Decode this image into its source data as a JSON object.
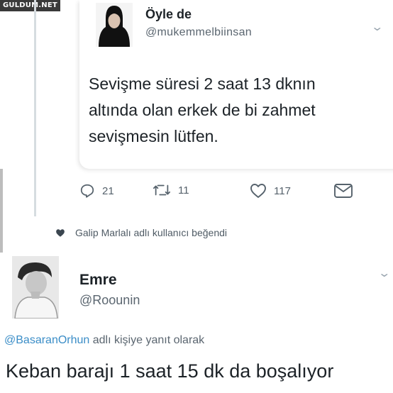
{
  "watermark": "GULDUM.NET",
  "quoted_tweet": {
    "display_name": "Öyle de",
    "handle": "@mukemmelbiinsan",
    "text_lines": [
      "Sevişme süresi 2 saat 13 dknın",
      "altında olan erkek de bi zahmet",
      "sevişmesin lütfen."
    ],
    "actions": {
      "reply_count": "21",
      "retweet_count": "11",
      "like_count": "117"
    },
    "liked_by_text": "Galip Marlalı adlı kullanıcı beğendi",
    "icons": [
      "reply-icon",
      "retweet-icon",
      "like-icon",
      "message-icon",
      "heart-icon",
      "chevron-down-icon"
    ]
  },
  "reply_tweet": {
    "display_name": "Emre",
    "handle": "@Roounin",
    "reply_mention": "@BasaranOrhun",
    "reply_suffix": " adlı kişiye yanıt olarak",
    "text": "Keban barajı 1 saat 15 dk da boşalıyor"
  },
  "colors": {
    "text": "#1c2227",
    "secondary": "#5b6670",
    "mention": "#3a8dc7",
    "thread_line": "#d6dce0"
  }
}
